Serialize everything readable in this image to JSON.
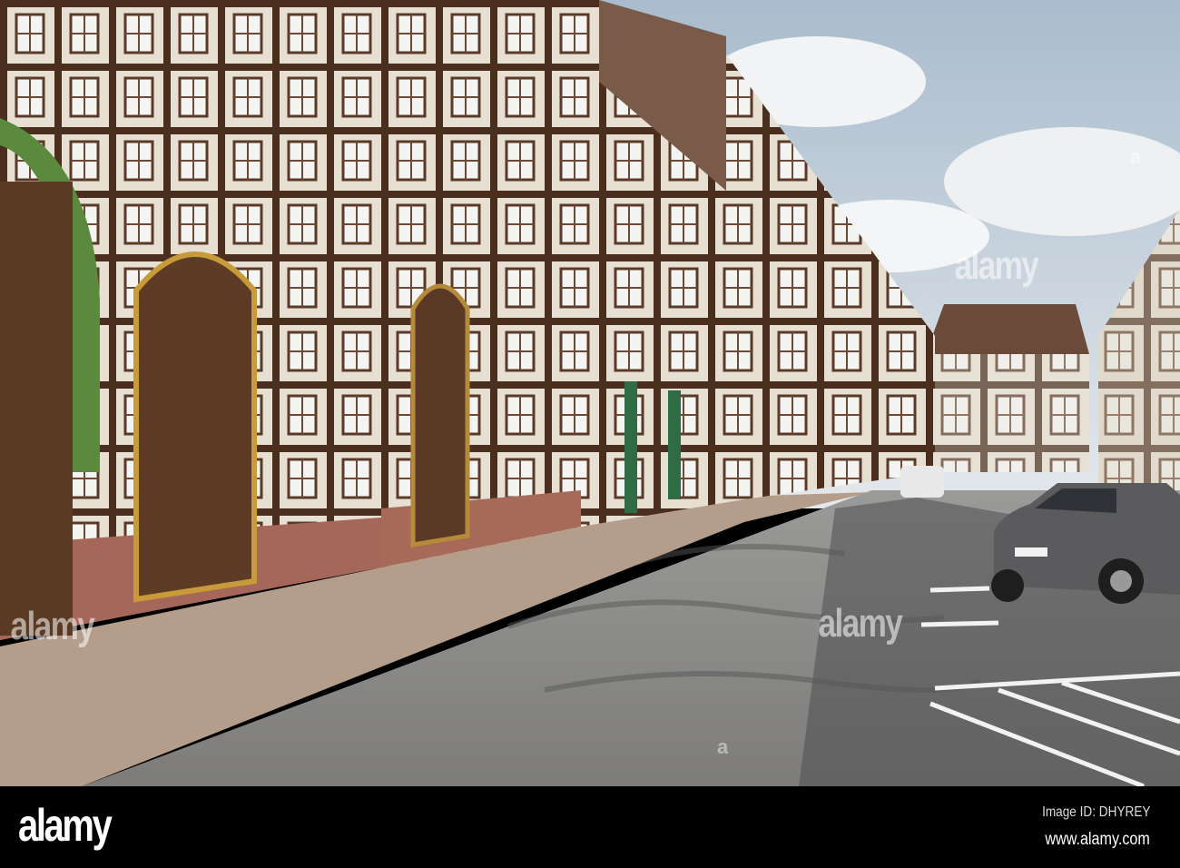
{
  "watermark": {
    "brand": "alamy",
    "center_mark": "alamy",
    "small_mark": "a"
  },
  "footer": {
    "logo": "alamy",
    "image_id": "Image ID: DHYREY",
    "url": "www.alamy.com"
  },
  "colors": {
    "sky": "#c9d4e0",
    "timber": "#4a2e1e",
    "plaster": "#e8e2d6",
    "road": "#8a8a88",
    "sidewalk": "#b49a88",
    "car": "#5a5a5c"
  }
}
